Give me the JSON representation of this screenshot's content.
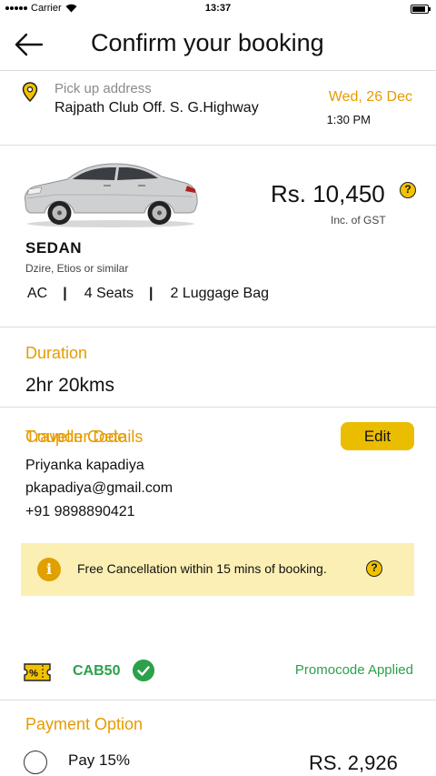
{
  "status_bar": {
    "carrier": "Carrier",
    "time": "13:37",
    "battery_level": 0.9
  },
  "header": {
    "title": "Confirm your booking",
    "back_icon": "back-arrow-icon"
  },
  "pickup": {
    "label": "Pick up address",
    "address": "Rajpath Club Off. S. G.Highway",
    "date": "Wed, 26 Dec",
    "time": "1:30 PM",
    "icon": "location-pin-icon"
  },
  "car": {
    "price": "Rs. 10,450",
    "price_note": "Inc. of GST",
    "type": "SEDAN",
    "models": "Dzire, Etios or similar",
    "features": [
      "AC",
      "4 Seats",
      "2 Luggage Bag"
    ],
    "help_icon_glyph": "?"
  },
  "duration": {
    "heading": "Duration",
    "value": "2hr 20kms"
  },
  "traveller": {
    "heading": "Traveller Details",
    "edit_label": "Edit",
    "name": "Priyanka kapadiya",
    "email": "pkapadiya@gmail.com",
    "phone": "+91 9898890421"
  },
  "notice": {
    "icon_glyph": "i",
    "text": "Free Cancellation within 15 mins of booking.",
    "help_icon_glyph": "?"
  },
  "coupon": {
    "heading": "Coupon Code",
    "code": "CAB50",
    "status": "Promocode Applied",
    "icon_glyph": "%"
  },
  "payment": {
    "heading": "Payment Option",
    "option_label": "Pay 15%",
    "amount": "RS. 2,926"
  },
  "colors": {
    "accent": "#e69b00",
    "button": "#ebbd00",
    "success": "#2ba14a",
    "notice_bg": "#fbefb4"
  }
}
